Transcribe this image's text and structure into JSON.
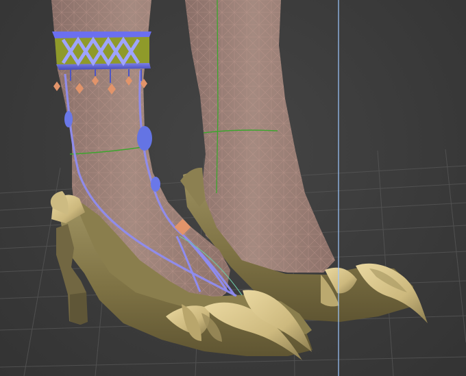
{
  "viewport": {
    "background_color": "#3a3a3a",
    "grid_color": "#555555",
    "selection_line_color": "#9fc8ff"
  },
  "model": {
    "skin_color": "#a08378",
    "wireframe_color": "#c09b90",
    "edge_loop_color": "#3ca62c",
    "shoe_color": "#8f8350",
    "claw_color": "#d8c68c",
    "anklet_band_color": "#5a5fd8",
    "anklet_pattern_color": "#8f9a2a",
    "gem_color": "#6a78e8",
    "charm_color": "#e2946a"
  },
  "icons": [
    "viewport-grid",
    "foot-mesh",
    "anklet",
    "shoe",
    "claw-ornament"
  ]
}
